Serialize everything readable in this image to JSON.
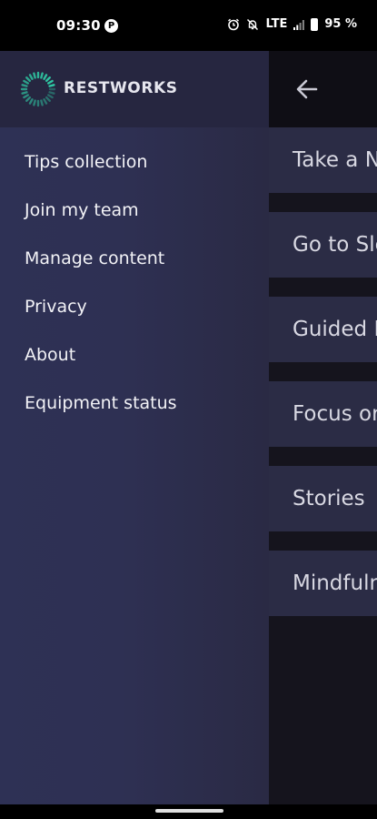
{
  "status_bar": {
    "time": "09:30",
    "app_badge": "P",
    "network": "LTE",
    "battery": "95 %"
  },
  "drawer": {
    "brand": "RESTWORKS",
    "accent_color": "#2fd0a8",
    "items": [
      {
        "label": "Tips collection"
      },
      {
        "label": "Join my team"
      },
      {
        "label": "Manage content"
      },
      {
        "label": "Privacy"
      },
      {
        "label": "About"
      },
      {
        "label": "Equipment status"
      }
    ]
  },
  "main": {
    "back_icon": "arrow-left-icon",
    "items": [
      {
        "label": "Take a N"
      },
      {
        "label": "Go to Sle"
      },
      {
        "label": "Guided I"
      },
      {
        "label": "Focus or"
      },
      {
        "label": "Stories"
      },
      {
        "label": "Mindfuln"
      }
    ]
  }
}
